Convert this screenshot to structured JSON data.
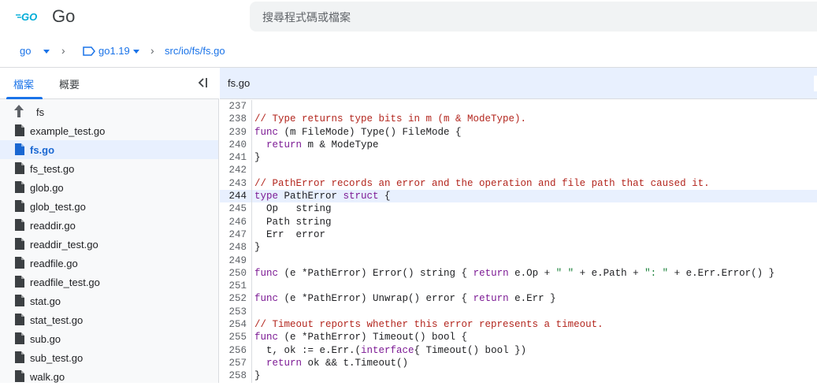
{
  "header": {
    "brand": "Go",
    "search_placeholder": "搜尋程式碼或檔案"
  },
  "breadcrumb": {
    "repo": "go",
    "ref": "go1.19",
    "path": "src/io/fs/fs.go"
  },
  "sidebar": {
    "tab_files": "檔案",
    "tab_overview": "概要",
    "parent": "fs",
    "files": [
      {
        "name": "example_test.go",
        "selected": false
      },
      {
        "name": "fs.go",
        "selected": true
      },
      {
        "name": "fs_test.go",
        "selected": false
      },
      {
        "name": "glob.go",
        "selected": false
      },
      {
        "name": "glob_test.go",
        "selected": false
      },
      {
        "name": "readdir.go",
        "selected": false
      },
      {
        "name": "readdir_test.go",
        "selected": false
      },
      {
        "name": "readfile.go",
        "selected": false
      },
      {
        "name": "readfile_test.go",
        "selected": false
      },
      {
        "name": "stat.go",
        "selected": false
      },
      {
        "name": "stat_test.go",
        "selected": false
      },
      {
        "name": "sub.go",
        "selected": false
      },
      {
        "name": "sub_test.go",
        "selected": false
      },
      {
        "name": "walk.go",
        "selected": false
      }
    ]
  },
  "editor": {
    "title": "fs.go",
    "current_line": 244,
    "lines": [
      {
        "n": "237",
        "t": ""
      },
      {
        "n": "238",
        "t": "<span class=\"cm\">// Type returns type bits in m (m &amp; ModeType).</span>"
      },
      {
        "n": "239",
        "t": "<span class=\"kw\">func</span> (m FileMode) Type() FileMode {"
      },
      {
        "n": "240",
        "t": "  <span class=\"kw\">return</span> m &amp; ModeType"
      },
      {
        "n": "241",
        "t": "}"
      },
      {
        "n": "242",
        "t": ""
      },
      {
        "n": "243",
        "t": "<span class=\"cm\">// PathError records an error and the operation and file path that caused it.</span>"
      },
      {
        "n": "244",
        "t": "<span class=\"kw\">type</span> PathError <span class=\"kw\">struct</span> {"
      },
      {
        "n": "245",
        "t": "  Op   string"
      },
      {
        "n": "246",
        "t": "  Path string"
      },
      {
        "n": "247",
        "t": "  Err  error"
      },
      {
        "n": "248",
        "t": "}"
      },
      {
        "n": "249",
        "t": ""
      },
      {
        "n": "250",
        "t": "<span class=\"kw\">func</span> (e *PathError) Error() string { <span class=\"kw\">return</span> e.Op + <span class=\"st\">\" \"</span> + e.Path + <span class=\"st\">\": \"</span> + e.Err.Error() }"
      },
      {
        "n": "251",
        "t": ""
      },
      {
        "n": "252",
        "t": "<span class=\"kw\">func</span> (e *PathError) Unwrap() error { <span class=\"kw\">return</span> e.Err }"
      },
      {
        "n": "253",
        "t": ""
      },
      {
        "n": "254",
        "t": "<span class=\"cm\">// Timeout reports whether this error represents a timeout.</span>"
      },
      {
        "n": "255",
        "t": "<span class=\"kw\">func</span> (e *PathError) Timeout() bool {"
      },
      {
        "n": "256",
        "t": "  t, ok := e.Err.(<span class=\"kw\">interface</span>{ Timeout() bool })"
      },
      {
        "n": "257",
        "t": "  <span class=\"kw\">return</span> ok &amp;&amp; t.Timeout()"
      },
      {
        "n": "258",
        "t": "}"
      }
    ]
  },
  "colors": {
    "accent": "#1a73e8",
    "selected_bg": "#e8f0fe",
    "comment": "#b3261e",
    "keyword": "#7c1a94"
  }
}
